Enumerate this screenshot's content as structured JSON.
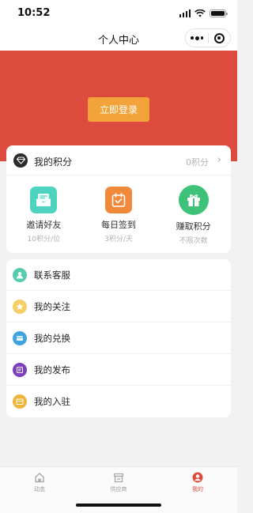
{
  "status_bar": {
    "time": "10:52"
  },
  "nav": {
    "title": "个人中心"
  },
  "hero": {
    "login_label": "立即登录"
  },
  "points": {
    "title": "我的积分",
    "value": "0积分",
    "icon": "diamond-icon",
    "actions": [
      {
        "label": "邀请好友",
        "sub": "10积分/位",
        "icon": "envelope-icon",
        "color": "#4ed3c1"
      },
      {
        "label": "每日签到",
        "sub": "3积分/天",
        "icon": "calendar-check-icon",
        "color": "#f08a3a"
      },
      {
        "label": "赚取积分",
        "sub": "不限次数",
        "icon": "gift-icon",
        "color": "#3ec27a"
      }
    ]
  },
  "menu": [
    {
      "label": "联系客服",
      "icon": "customer-service-icon",
      "color": "#55cbb0"
    },
    {
      "label": "我的关注",
      "icon": "star-icon",
      "color": "#f6cf63"
    },
    {
      "label": "我的兑换",
      "icon": "exchange-icon",
      "color": "#3fa4e0"
    },
    {
      "label": "我的发布",
      "icon": "publish-icon",
      "color": "#7c3fbe"
    },
    {
      "label": "我的入驻",
      "icon": "store-icon",
      "color": "#f0b43c"
    }
  ],
  "tabs": [
    {
      "label": "动态",
      "icon": "home-icon",
      "active": false
    },
    {
      "label": "供应商",
      "icon": "supplier-icon",
      "active": false
    },
    {
      "label": "我的",
      "icon": "user-icon",
      "active": true
    }
  ],
  "colors": {
    "accent": "#dd4a3e",
    "login_button": "#f2a43a"
  }
}
